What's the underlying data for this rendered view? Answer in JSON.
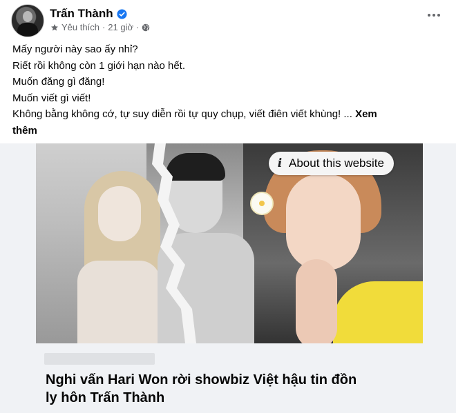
{
  "post": {
    "author": "Trấn Thành",
    "audience_label": "Yêu thích",
    "separator": "·",
    "time": "21 giờ",
    "separator2": "·",
    "text_lines": [
      "Mấy người này sao ấy nhỉ?",
      "Riết rồi không còn 1 giới hạn nào hết.",
      "Muốn đăng gì đăng!",
      "Muốn viết gì viết!"
    ],
    "text_last_line": "Không bằng không cớ, tự suy diễn rồi tự quy chụp, viết điên viết khùng! ...",
    "see_more_part1": "Xem",
    "see_more_part2": "thêm"
  },
  "link_card": {
    "about_label": "About this website",
    "headline_line1": "Nghi vấn Hari Won rời showbiz Việt hậu tin đồn",
    "headline_line2": "ly hôn Trấn Thành"
  },
  "icons": {
    "verified": "verified-badge-icon",
    "favorite": "star-icon",
    "privacy": "globe-icon",
    "more": "more-options-icon",
    "info": "info-icon"
  },
  "colors": {
    "verified_blue": "#1877f2",
    "meta_gray": "#65676b",
    "card_bg": "#f0f2f5"
  }
}
